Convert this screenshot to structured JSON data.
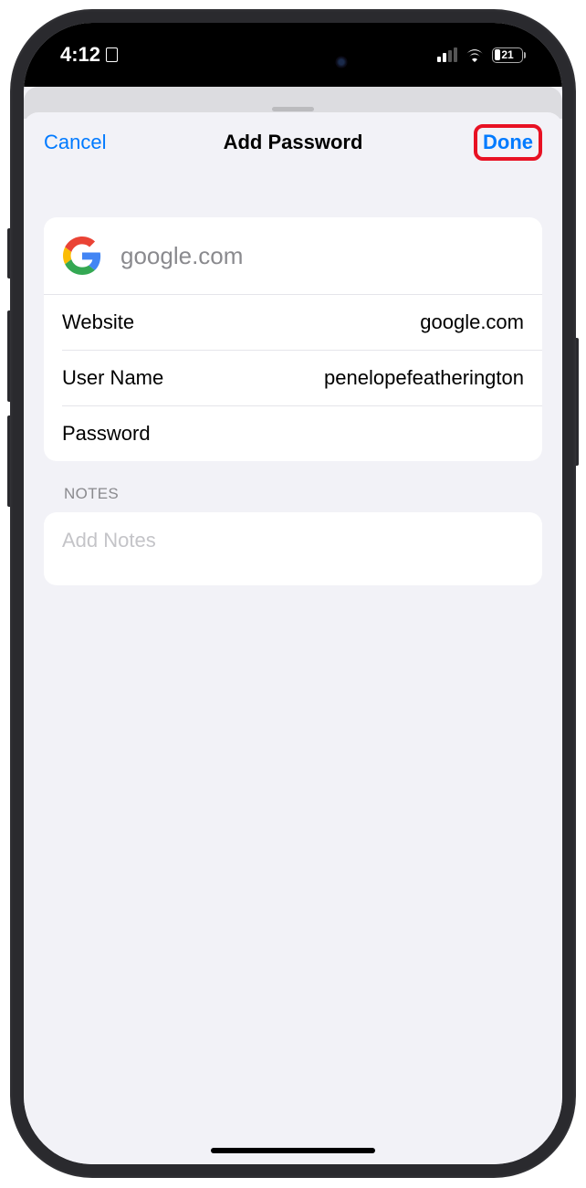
{
  "status_bar": {
    "time": "4:12",
    "battery_percent": "21"
  },
  "nav": {
    "cancel": "Cancel",
    "title": "Add Password",
    "done": "Done"
  },
  "site": {
    "display": "google.com"
  },
  "fields": {
    "website_label": "Website",
    "website_value": "google.com",
    "username_label": "User Name",
    "username_value": "penelopefeatherington",
    "password_label": "Password",
    "password_value": ""
  },
  "notes": {
    "header": "NOTES",
    "placeholder": "Add Notes"
  }
}
